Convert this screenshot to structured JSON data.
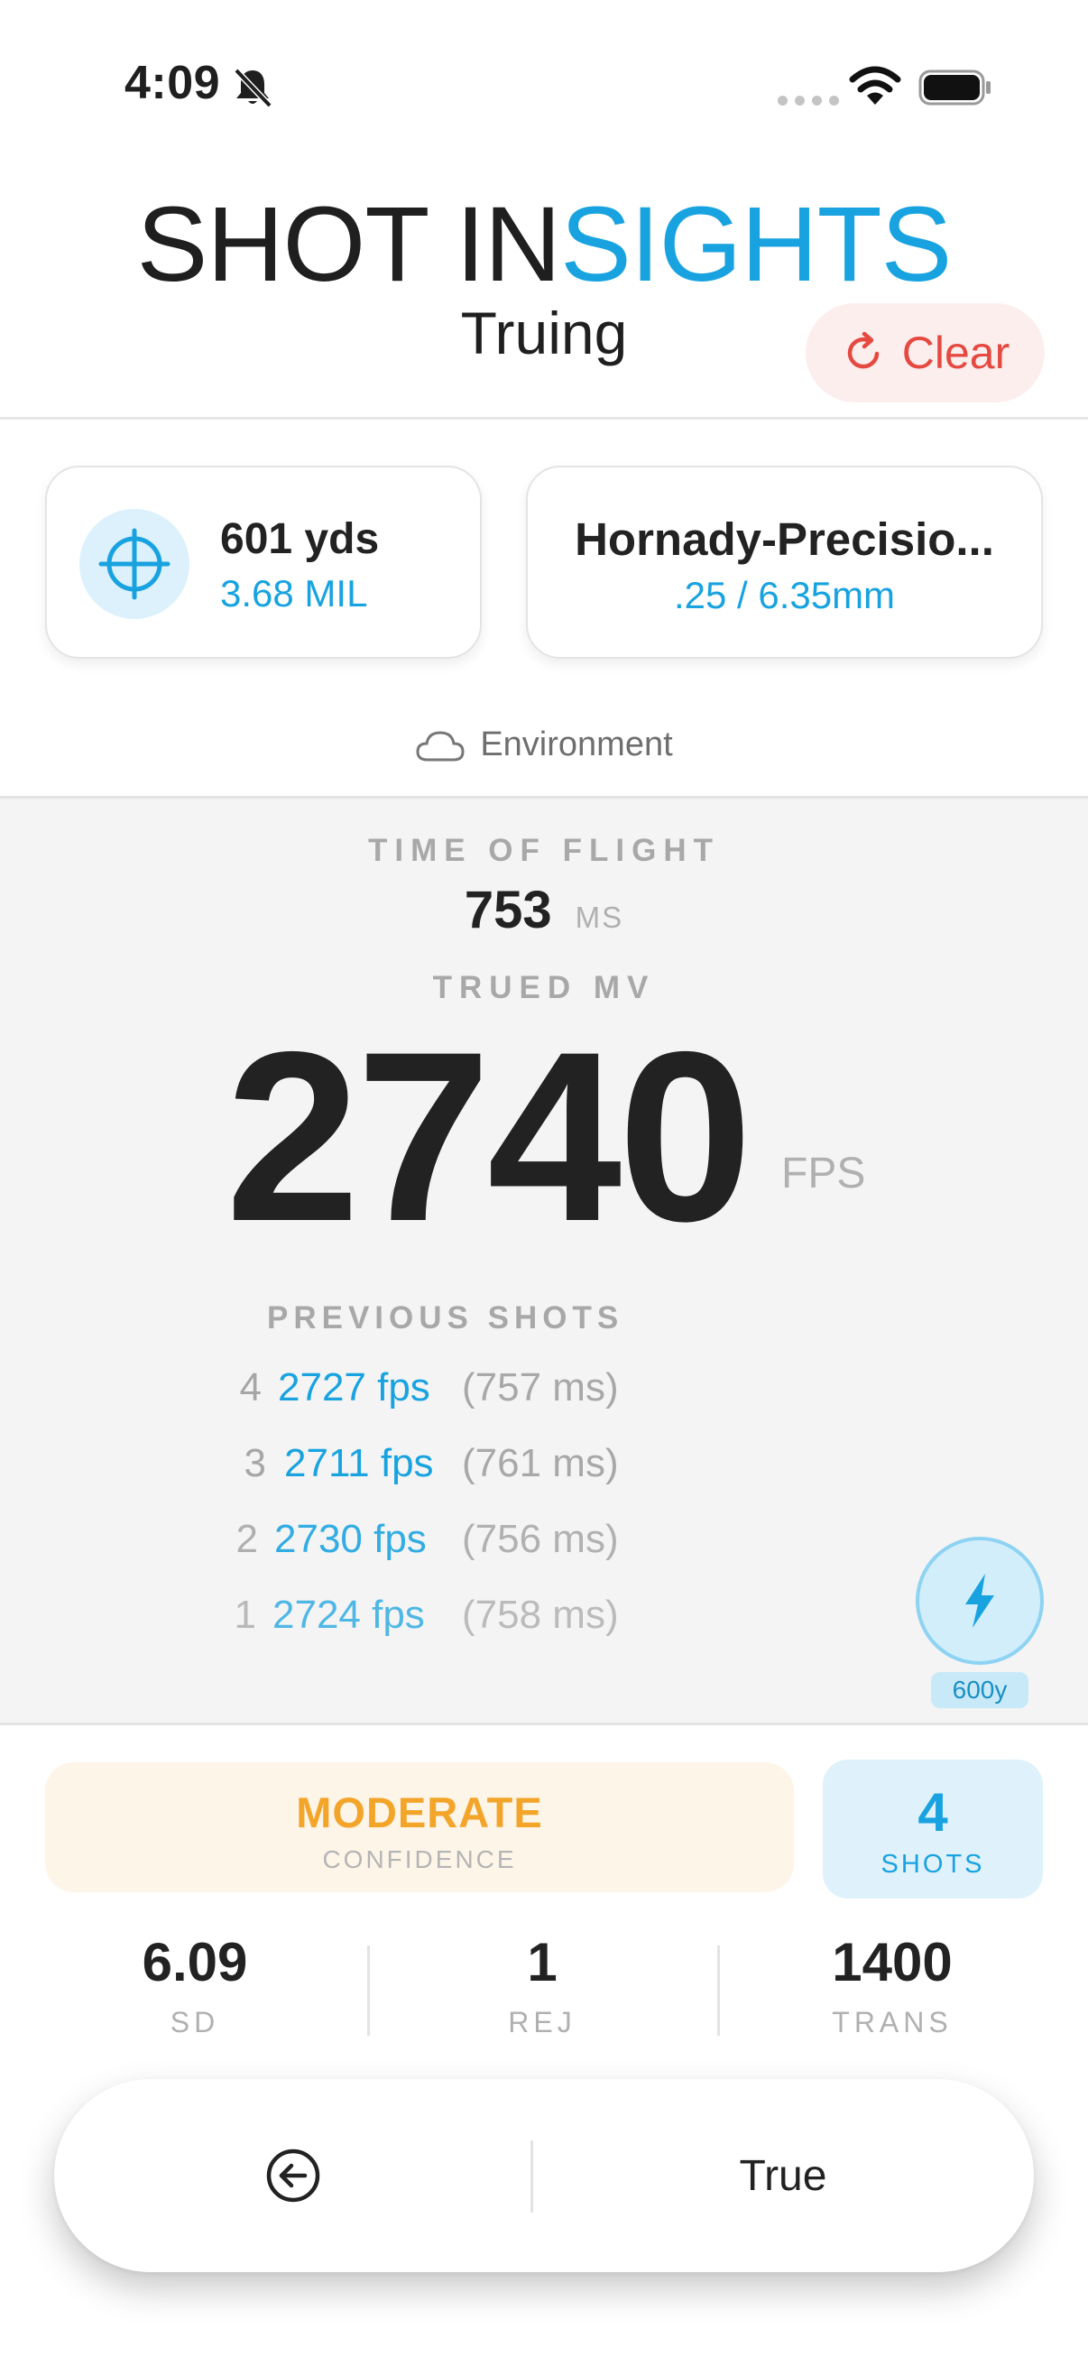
{
  "status_bar": {
    "time": "4:09"
  },
  "header": {
    "title_part1": "SHOT IN",
    "title_part2": "SIGHTS",
    "subtitle": "Truing",
    "clear_label": "Clear"
  },
  "range_card": {
    "distance": "601 yds",
    "mil": "3.68 MIL"
  },
  "ammo_card": {
    "name": "Hornady-Precisio...",
    "spec": ".25 / 6.35mm"
  },
  "environment": {
    "label": "Environment"
  },
  "results": {
    "tof_label": "TIME OF FLIGHT",
    "tof_value": "753",
    "tof_unit": "MS",
    "trued_label": "TRUED MV",
    "mv_value": "2740",
    "mv_unit": "FPS",
    "previous_label": "PREVIOUS SHOTS",
    "shots": [
      {
        "num": "4",
        "fps": "2727 fps",
        "ms": "(757 ms)"
      },
      {
        "num": "3",
        "fps": "2711 fps",
        "ms": "(761 ms)"
      },
      {
        "num": "2",
        "fps": "2730 fps",
        "ms": "(756 ms)"
      },
      {
        "num": "1",
        "fps": "2724 fps",
        "ms": "(758 ms)"
      }
    ],
    "preset_badge": "600y"
  },
  "confidence": {
    "level": "MODERATE",
    "caption": "CONFIDENCE"
  },
  "shots_summary": {
    "count": "4",
    "caption": "SHOTS"
  },
  "stats": [
    {
      "value": "6.09",
      "label": "SD"
    },
    {
      "value": "1",
      "label": "REJ"
    },
    {
      "value": "1400",
      "label": "TRANS"
    }
  ],
  "bottom_bar": {
    "true_label": "True"
  },
  "colors": {
    "accent": "#18a3e0",
    "warning": "#f3a52a",
    "danger": "#e5493f"
  }
}
